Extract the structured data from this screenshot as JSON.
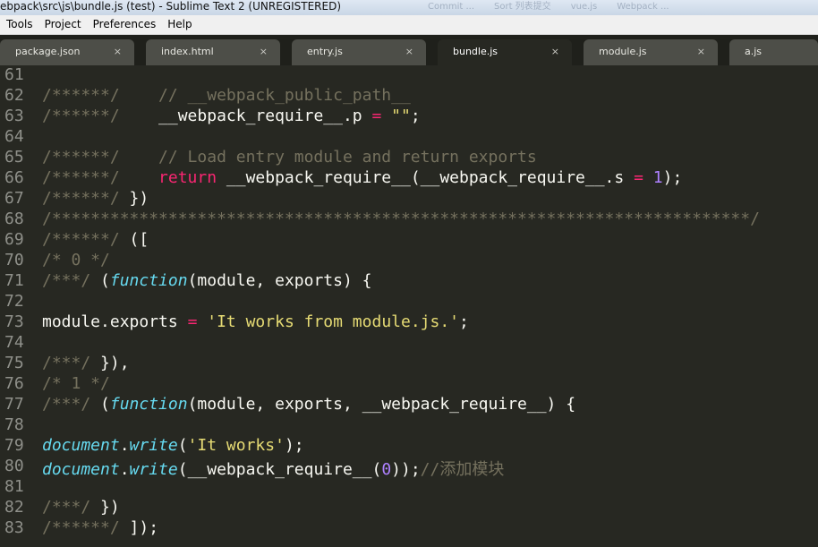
{
  "window": {
    "title": "ebpack\\src\\js\\bundle.js (test) - Sublime Text 2 (UNREGISTERED)",
    "taskbar_items": [
      "Commit ...",
      "Sort 列表提交",
      "vue.js",
      "Webpack ..."
    ]
  },
  "menu": [
    "Tools",
    "Project",
    "Preferences",
    "Help"
  ],
  "tabs": [
    {
      "label": "package.json",
      "active": false
    },
    {
      "label": "index.html",
      "active": false
    },
    {
      "label": "entry.js",
      "active": false
    },
    {
      "label": "bundle.js",
      "active": true
    },
    {
      "label": "module.js",
      "active": false
    },
    {
      "label": "a.js",
      "active": false
    }
  ],
  "tab_close_glyph": "×",
  "colors": {
    "background": "#272822",
    "comment": "#75715e",
    "keyword": "#f92672",
    "string": "#e6db74",
    "number": "#ae81ff",
    "function_keyword": "#66d9ef",
    "method": "#a6e22e",
    "text": "#f8f8f2",
    "gutter": "#8f908a"
  },
  "lines": [
    {
      "num": "61",
      "tokens": []
    },
    {
      "num": "62",
      "tokens": [
        {
          "t": "/******/    // __webpack_public_path__",
          "c": "c"
        }
      ]
    },
    {
      "num": "63",
      "tokens": [
        {
          "t": "/******/    ",
          "c": "c"
        },
        {
          "t": "__webpack_require__.p ",
          "c": ""
        },
        {
          "t": "=",
          "c": "k"
        },
        {
          "t": " ",
          "c": ""
        },
        {
          "t": "\"\"",
          "c": "s"
        },
        {
          "t": ";",
          "c": ""
        }
      ]
    },
    {
      "num": "64",
      "tokens": []
    },
    {
      "num": "65",
      "tokens": [
        {
          "t": "/******/    // Load entry module and return exports",
          "c": "c"
        }
      ]
    },
    {
      "num": "66",
      "tokens": [
        {
          "t": "/******/    ",
          "c": "c"
        },
        {
          "t": "return",
          "c": "k"
        },
        {
          "t": " __webpack_require__(__webpack_require__.s ",
          "c": ""
        },
        {
          "t": "=",
          "c": "k"
        },
        {
          "t": " ",
          "c": ""
        },
        {
          "t": "1",
          "c": "n"
        },
        {
          "t": ");",
          "c": ""
        }
      ]
    },
    {
      "num": "67",
      "tokens": [
        {
          "t": "/******/ ",
          "c": "c"
        },
        {
          "t": "})",
          "c": ""
        }
      ]
    },
    {
      "num": "68",
      "tokens": [
        {
          "t": "/************************************************************************/",
          "c": "c"
        }
      ]
    },
    {
      "num": "69",
      "tokens": [
        {
          "t": "/******/ ",
          "c": "c"
        },
        {
          "t": "([",
          "c": ""
        }
      ]
    },
    {
      "num": "70",
      "tokens": [
        {
          "t": "/* 0 */",
          "c": "c"
        }
      ]
    },
    {
      "num": "71",
      "tokens": [
        {
          "t": "/***/ ",
          "c": "c"
        },
        {
          "t": "(",
          "c": ""
        },
        {
          "t": "function",
          "c": "f"
        },
        {
          "t": "(module, exports) {",
          "c": ""
        }
      ]
    },
    {
      "num": "72",
      "tokens": []
    },
    {
      "num": "73",
      "tokens": [
        {
          "t": "module.exports ",
          "c": ""
        },
        {
          "t": "=",
          "c": "k"
        },
        {
          "t": " ",
          "c": ""
        },
        {
          "t": "'It works from module.js.'",
          "c": "s"
        },
        {
          "t": ";",
          "c": ""
        }
      ]
    },
    {
      "num": "74",
      "tokens": []
    },
    {
      "num": "75",
      "tokens": [
        {
          "t": "/***/ ",
          "c": "c"
        },
        {
          "t": "}),",
          "c": ""
        }
      ]
    },
    {
      "num": "76",
      "tokens": [
        {
          "t": "/* 1 */",
          "c": "c"
        }
      ]
    },
    {
      "num": "77",
      "tokens": [
        {
          "t": "/***/ ",
          "c": "c"
        },
        {
          "t": "(",
          "c": ""
        },
        {
          "t": "function",
          "c": "f"
        },
        {
          "t": "(module, exports, __webpack_require__) {",
          "c": ""
        }
      ]
    },
    {
      "num": "78",
      "tokens": []
    },
    {
      "num": "79",
      "tokens": [
        {
          "t": "document",
          "c": "f"
        },
        {
          "t": ".",
          "c": ""
        },
        {
          "t": "write",
          "c": "f"
        },
        {
          "t": "(",
          "c": ""
        },
        {
          "t": "'It works'",
          "c": "s"
        },
        {
          "t": ");",
          "c": ""
        }
      ]
    },
    {
      "num": "80",
      "tokens": [
        {
          "t": "document",
          "c": "f"
        },
        {
          "t": ".",
          "c": ""
        },
        {
          "t": "write",
          "c": "f"
        },
        {
          "t": "(__webpack_require__(",
          "c": ""
        },
        {
          "t": "0",
          "c": "n"
        },
        {
          "t": "));",
          "c": ""
        },
        {
          "t": "//添加模块",
          "c": "c"
        }
      ]
    },
    {
      "num": "81",
      "tokens": []
    },
    {
      "num": "82",
      "tokens": [
        {
          "t": "/***/ ",
          "c": "c"
        },
        {
          "t": "})",
          "c": ""
        }
      ]
    },
    {
      "num": "83",
      "tokens": [
        {
          "t": "/******/ ",
          "c": "c"
        },
        {
          "t": "]);",
          "c": ""
        }
      ]
    }
  ]
}
